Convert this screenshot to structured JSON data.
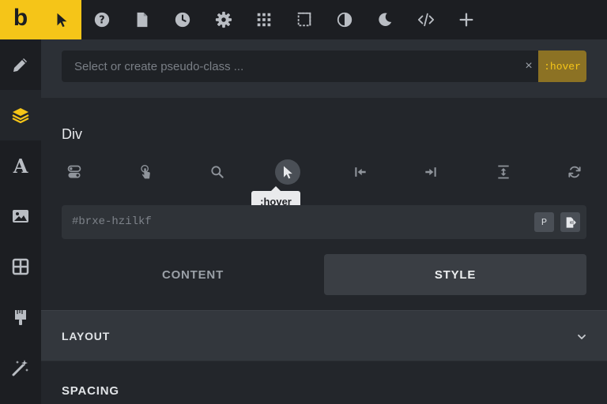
{
  "brand": {
    "logo_letter": "b",
    "accent": "#f5c518"
  },
  "toolbar": {
    "icons": [
      "cursor-icon",
      "help-icon",
      "page-icon",
      "history-icon",
      "settings-icon",
      "grid-icon",
      "breakpoint-icon",
      "contrast-icon",
      "dark-mode-icon",
      "code-icon",
      "plus-icon"
    ]
  },
  "sidebar": {
    "items": [
      "pencil-icon",
      "layers-icon",
      "typography-icon",
      "image-icon",
      "grid-layout-icon",
      "brush-icon",
      "magic-wand-icon"
    ],
    "active_index": 1
  },
  "pseudo": {
    "placeholder": "Select or create pseudo-class ...",
    "clear": "×",
    "active": ":hover"
  },
  "element": {
    "title": "Div",
    "states": [
      "toggle-icon",
      "touch-icon",
      "search-icon",
      "cursor-icon",
      "first-icon",
      "last-icon",
      "vertical-spacing-icon",
      "refresh-icon"
    ],
    "active_state_index": 3,
    "tooltip": ":hover"
  },
  "css_id": {
    "value": "#brxe-hzilkf",
    "p_label": "P"
  },
  "tabs": [
    {
      "label": "CONTENT",
      "active": false
    },
    {
      "label": "STYLE",
      "active": true
    }
  ],
  "sections": {
    "layout": "LAYOUT",
    "spacing": "SPACING"
  }
}
